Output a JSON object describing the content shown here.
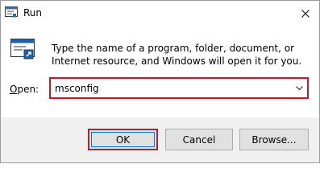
{
  "window": {
    "title": "Run",
    "title_icon": "run-app-icon",
    "close_icon": "close-icon"
  },
  "content": {
    "icon": "run-icon",
    "description": "Type the name of a program, folder, document, or Internet resource, and Windows will open it for you.",
    "open_label_accel": "O",
    "open_label_rest": "pen:",
    "open_input_value": "msconfig",
    "dropdown_icon": "chevron-down-icon"
  },
  "buttons": {
    "ok_label": "OK",
    "cancel_label": "Cancel",
    "browse_label": "Browse..."
  },
  "colors": {
    "highlight": "#b81d2b",
    "focus_border": "#0078d7",
    "footer_background": "#f0f0f0"
  }
}
